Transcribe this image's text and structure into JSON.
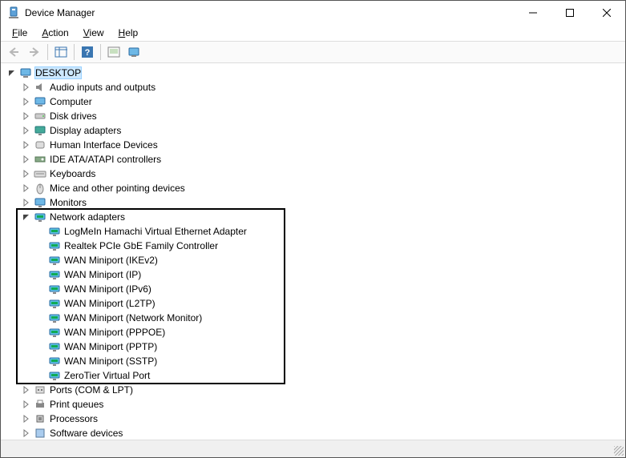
{
  "window": {
    "title": "Device Manager"
  },
  "menu": {
    "file": "File",
    "action": "Action",
    "view": "View",
    "help": "Help"
  },
  "tree": {
    "root": "DESKTOP",
    "categories": [
      {
        "name": "Audio inputs and outputs",
        "icon": "audio"
      },
      {
        "name": "Computer",
        "icon": "computer"
      },
      {
        "name": "Disk drives",
        "icon": "disk"
      },
      {
        "name": "Display adapters",
        "icon": "display"
      },
      {
        "name": "Human Interface Devices",
        "icon": "hid"
      },
      {
        "name": "IDE ATA/ATAPI controllers",
        "icon": "ide"
      },
      {
        "name": "Keyboards",
        "icon": "keyboard"
      },
      {
        "name": "Mice and other pointing devices",
        "icon": "mouse"
      },
      {
        "name": "Monitors",
        "icon": "monitor"
      },
      {
        "name": "Network adapters",
        "icon": "network",
        "expanded": true,
        "children": [
          "LogMeIn Hamachi Virtual Ethernet Adapter",
          "Realtek PCIe GbE Family Controller",
          "WAN Miniport (IKEv2)",
          "WAN Miniport (IP)",
          "WAN Miniport (IPv6)",
          "WAN Miniport (L2TP)",
          "WAN Miniport (Network Monitor)",
          "WAN Miniport (PPPOE)",
          "WAN Miniport (PPTP)",
          "WAN Miniport (SSTP)",
          "ZeroTier Virtual Port"
        ]
      },
      {
        "name": "Ports (COM & LPT)",
        "icon": "ports"
      },
      {
        "name": "Print queues",
        "icon": "print"
      },
      {
        "name": "Processors",
        "icon": "cpu"
      },
      {
        "name": "Software devices",
        "icon": "software"
      }
    ]
  }
}
